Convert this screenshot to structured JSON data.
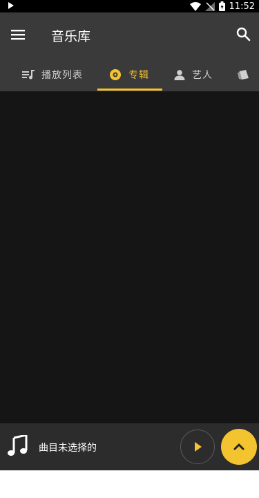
{
  "status_bar": {
    "time": "11:52"
  },
  "app_bar": {
    "title": "音乐库"
  },
  "tabs": [
    {
      "label": "播放列表",
      "icon": "playlist-icon"
    },
    {
      "label": "专辑",
      "icon": "album-icon",
      "active": true
    },
    {
      "label": "艺人",
      "icon": "artist-icon"
    },
    {
      "label": "",
      "icon": "genre-icon"
    }
  ],
  "player": {
    "track_title": "曲目未选择的"
  },
  "colors": {
    "accent": "#f4c430",
    "app_bar_bg": "#3a3a3a",
    "content_bg": "#151515",
    "player_bg": "#2c2c2c"
  }
}
